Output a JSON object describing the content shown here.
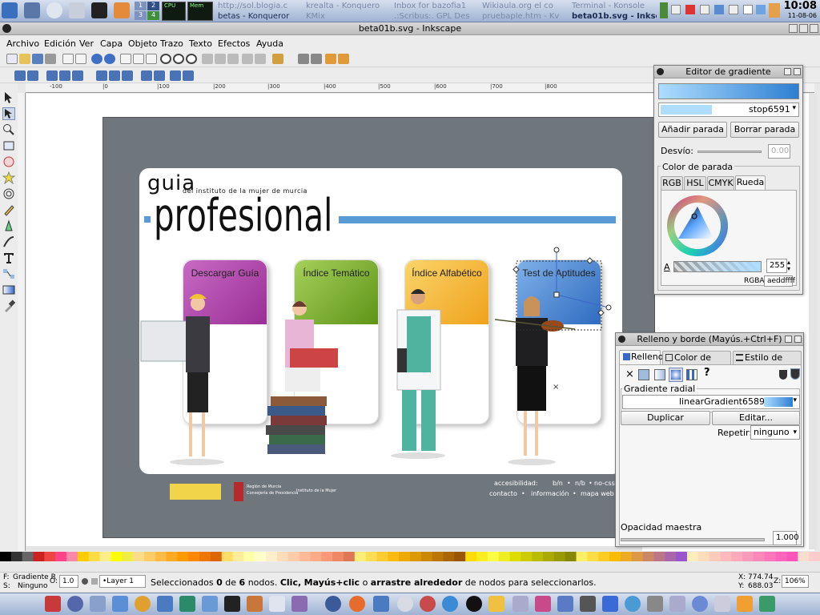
{
  "top_panel": {
    "tasks": [
      {
        "label": "http://sol.blogia.c",
        "dim": true
      },
      {
        "label": "betas - Konqueror",
        "dim": false
      },
      {
        "label": "krealta - Konquero",
        "dim": true
      },
      {
        "label": "KMix",
        "dim": true
      },
      {
        "label": "Inbox for bazofia1",
        "dim": true
      },
      {
        "label": ".:Scribus:. GPL Des",
        "dim": true
      },
      {
        "label": "Wikiaula.org el co",
        "dim": true
      },
      {
        "label": "pruebaple.htm - Kv",
        "dim": true
      },
      {
        "label": "Terminal - Konsole",
        "dim": true
      },
      {
        "label": "beta01b.svg - Inksc",
        "dim": false
      }
    ],
    "pager": [
      "1",
      "2",
      "3",
      "4"
    ],
    "monitors": [
      "CPU",
      "Mem"
    ],
    "clock_time": "10:08",
    "clock_date": "11-08-06"
  },
  "window": {
    "title": "beta01b.svg - Inkscape"
  },
  "menubar": [
    "Archivo",
    "Edición",
    "Ver",
    "Capa",
    "Objeto",
    "Trazo",
    "Texto",
    "Efectos",
    "Ayuda"
  ],
  "ruler_marks": [
    "-100",
    "|0",
    "|100",
    "|200",
    "|300",
    "|400",
    "|500",
    "|600",
    "|700",
    "|800"
  ],
  "artwork": {
    "title_small": "guia",
    "subtitle": "del instituto de la mujer de murcia",
    "title_big": "profesional",
    "tiles": [
      {
        "label": "Descargar Guía",
        "color": "#b63fb2"
      },
      {
        "label": "Índice Temático",
        "color": "#7cae2a"
      },
      {
        "label": "Índice Alfabético",
        "color": "#f3b22d"
      },
      {
        "label": "Test de Aptitudes",
        "color": "#3f7fce"
      }
    ],
    "footer": {
      "accesibilidad": "accesibilidad:",
      "links_top": [
        "b/n",
        "•",
        "n/b",
        "•",
        "no-css"
      ],
      "links_bottom": [
        "contacto",
        "•",
        "información",
        "•",
        "mapa web"
      ],
      "logo_region": "Región de Murcia",
      "logo_consejeria": "Consejería de Presidencia",
      "logo_instituto": "Instituto de la Mujer"
    }
  },
  "gradient_editor": {
    "title": "Editor de gradiente",
    "stop_name": "stop6591",
    "add_stop": "Añadir parada",
    "remove_stop": "Borrar parada",
    "offset_label": "Desvío:",
    "offset_value": "0.00",
    "stop_color_label": "Color de parada",
    "tabs": [
      "RGB",
      "HSL",
      "CMYK",
      "Rueda"
    ],
    "alpha_label": "A",
    "alpha_value": "255",
    "rgba_label": "RGBA:",
    "rgba_value": "aeddffff"
  },
  "fill_stroke": {
    "title": "Relleno y borde (Mayús.+Ctrl+F)",
    "tabs": [
      "Relleno",
      "Color de trazo",
      "Estilo de trazo"
    ],
    "question": "?",
    "x_mark": "×",
    "gradient_type": "Gradiente radial",
    "gradient_name": "linearGradient6589",
    "duplicate": "Duplicar",
    "edit": "Editar...",
    "repeat_label": "Repetir:",
    "repeat_value": "ninguno",
    "opacity_label": "Opacidad maestra",
    "opacity_value": "1.000"
  },
  "statusbar": {
    "fill_label": "F:",
    "fill_value": "Gradiente R",
    "stroke_label": "S:",
    "stroke_value": "Ninguno",
    "o_label": "O:",
    "o_value": "1.0",
    "layer": "•Layer 1",
    "message_prefix": "Seleccionados",
    "message_count": "0",
    "message_de": "de",
    "message_total": "6",
    "message_nodes": "nodos.",
    "message_clic": "Clic,",
    "message_mayus": "Mayús+clic",
    "message_o": "o",
    "message_drag": "arrastre alrededor",
    "message_rest": "de nodos para seleccionarlos.",
    "x_label": "X:",
    "x_value": "774.74",
    "y_label": "Y:",
    "y_value": "688.03",
    "zoom_label": "Z:",
    "zoom_value": "106%"
  },
  "colors": {
    "accent_blue": "#4a86c8",
    "page_grey": "#6f767c",
    "gradient_light": "#aeddff"
  }
}
